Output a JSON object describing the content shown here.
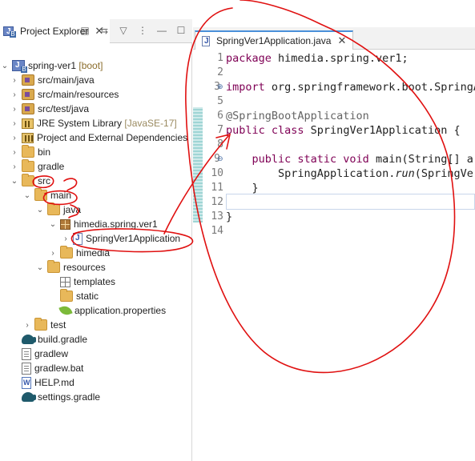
{
  "explorer": {
    "title": "Project Explorer",
    "close": "✕",
    "toolbar_icons": [
      "collapse-all-icon",
      "link-editor-icon",
      "filter-icon",
      "view-menu-icon",
      "minimize-icon",
      "maximize-icon"
    ]
  },
  "tree": {
    "project": {
      "name": "spring-ver1",
      "decoration": "[boot]"
    },
    "items": [
      {
        "label": "src/main/java"
      },
      {
        "label": "src/main/resources"
      },
      {
        "label": "src/test/java"
      },
      {
        "label": "JRE System Library",
        "decoration": "[JavaSE-17]"
      },
      {
        "label": "Project and External Dependencies"
      },
      {
        "label": "bin"
      },
      {
        "label": "gradle"
      },
      {
        "label": "src"
      },
      {
        "label": "main"
      },
      {
        "label": "java"
      },
      {
        "label": "himedia.spring.ver1"
      },
      {
        "label": "SpringVer1Application"
      },
      {
        "label": "himedia"
      },
      {
        "label": "resources"
      },
      {
        "label": "templates"
      },
      {
        "label": "static"
      },
      {
        "label": "application.properties"
      },
      {
        "label": "test"
      },
      {
        "label": "build.gradle"
      },
      {
        "label": "gradlew"
      },
      {
        "label": "gradlew.bat"
      },
      {
        "label": "HELP.md"
      },
      {
        "label": "settings.gradle"
      }
    ]
  },
  "editor": {
    "tab_label": "SpringVer1Application.java",
    "close": "✕",
    "line_numbers": [
      "1",
      "2",
      "3",
      "5",
      "6",
      "7",
      "8",
      "9",
      "10",
      "11",
      "12",
      "13",
      "14"
    ],
    "lines": {
      "l1": {
        "kw": "package",
        "rest": " himedia.spring.ver1;"
      },
      "l3": {
        "kw": "import",
        "rest": " org.springframework.boot.SpringA"
      },
      "l6": {
        "ann": "@SpringBootApplication"
      },
      "l7": {
        "kw": "public class",
        "rest": " SpringVer1Application {"
      },
      "l9": {
        "kw": "    public static void",
        "rest": " main(String[] ar"
      },
      "l10": {
        "pre": "        SpringApplication.",
        "it": "run",
        "post": "(SpringVer"
      },
      "l11": {
        "text": "    }"
      },
      "l13": {
        "text": "}"
      }
    }
  }
}
